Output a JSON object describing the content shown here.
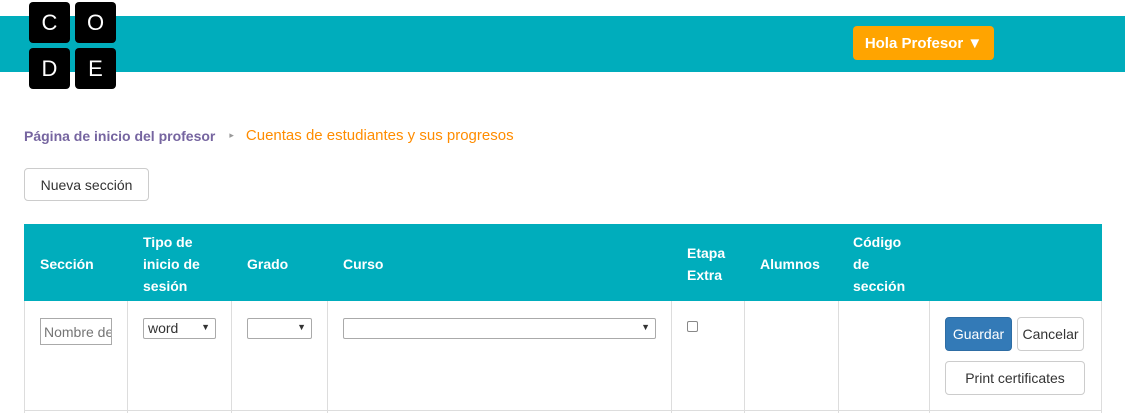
{
  "logo": {
    "letters": [
      "C",
      "O",
      "D",
      "E"
    ]
  },
  "header": {
    "user_menu_label": "Hola Profesor ▼"
  },
  "breadcrumb": {
    "home": "Página de inicio del profesor",
    "separator": "▸",
    "current": "Cuentas de estudiantes y sus progresos"
  },
  "toolbar": {
    "new_section_label": "Nueva sección"
  },
  "table": {
    "headers": {
      "section": "Sección",
      "login_type": [
        "Tipo de",
        "inicio de",
        "sesión"
      ],
      "grade": "Grado",
      "course": "Curso",
      "extra_stage": [
        "Etapa",
        "Extra"
      ],
      "students": "Alumnos",
      "section_code": [
        "Código",
        "de",
        "sección"
      ]
    },
    "row": {
      "name_placeholder": "Nombre de la sección",
      "login_type_value": "word",
      "grade_value": "",
      "course_value": "",
      "extra_stage_checked": false,
      "save_label": "Guardar",
      "cancel_label": "Cancelar",
      "print_label": "Print certificates"
    }
  },
  "colors": {
    "header_bg": "#00adbc",
    "user_button": "#ffa400",
    "breadcrumb_home": "#7665a0",
    "breadcrumb_current": "#ff8c00",
    "primary_button": "#337ab7"
  }
}
